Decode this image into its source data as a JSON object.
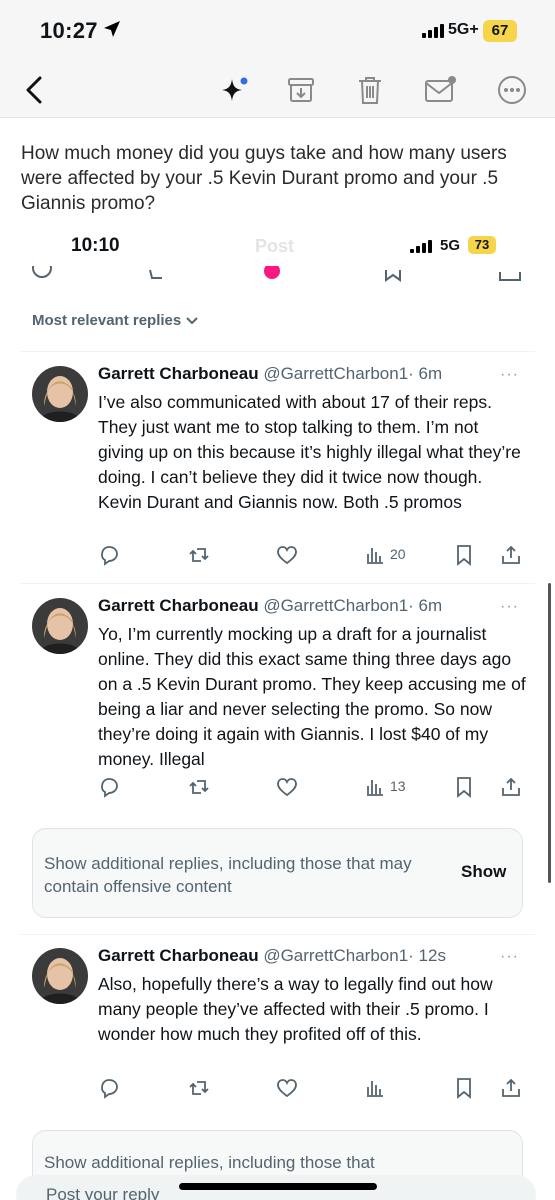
{
  "status_outer": {
    "time": "10:27",
    "network": "5G+",
    "battery": "67"
  },
  "mail_toolbar": {
    "icons": [
      "back-chevron-icon",
      "sparkle-icon",
      "archive-icon",
      "trash-icon",
      "mail-unread-icon",
      "more-circle-icon"
    ],
    "accent": "#2f6fe4"
  },
  "email": {
    "body": "How much money did you guys take and how many users were affected by your .5 Kevin Durant promo and your .5 Giannis promo?"
  },
  "status_inner": {
    "time": "10:10",
    "ghost_title": "Post",
    "network": "5G",
    "battery": "73"
  },
  "replies_filter": {
    "label": "Most relevant replies"
  },
  "tweets": [
    {
      "name": "Garrett Charboneau",
      "handle": "@GarrettCharbon1",
      "time": "· 6m",
      "more": "···",
      "body": "I’ve also communicated with about 17 of their reps. They just want me to stop talking to them. I’m not giving up on this because it’s highly illegal what they’re doing. I can’t believe they did it twice now though. Kevin Durant and Giannis now. Both .5 promos",
      "views": "20"
    },
    {
      "name": "Garrett Charboneau",
      "handle": "@GarrettCharbon1",
      "time": "· 6m",
      "more": "···",
      "body": "Yo, I’m currently mocking up a draft for a journalist online. They did this exact same thing three days ago on a .5 Kevin Durant promo. They keep accusing me of being a liar and never selecting the promo. So now they’re doing it again with Giannis. I lost $40 of my money. Illegal",
      "views": "13"
    },
    {
      "name": "Garrett Charboneau",
      "handle": "@GarrettCharbon1",
      "time": "· 12s",
      "more": "···",
      "body": "Also, hopefully there’s a way to legally find out how many people they’ve affected with their .5 promo. I wonder how much they profited off of this.",
      "views": ""
    }
  ],
  "notice": {
    "text": "Show additional replies, including those that may contain offensive content",
    "button": "Show",
    "partial_text": "Show additional replies, including those that"
  },
  "compose": {
    "placeholder": "Post your reply"
  }
}
